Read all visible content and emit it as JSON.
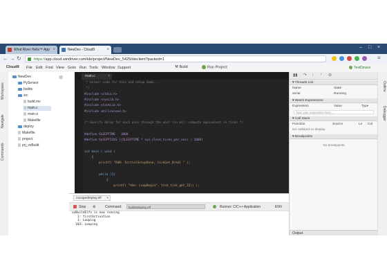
{
  "browser": {
    "tabs": [
      {
        "label": "Wind River Helix™ App"
      },
      {
        "label": "NewDev - Cloud9"
      }
    ],
    "url_scheme": "https://",
    "url_rest": "app.cloud.windriver.com/ide/project/NewDev_5425/ideclient?packed=1"
  },
  "ide": {
    "logo": "Cloud9",
    "menu": [
      "File",
      "Edit",
      "Find",
      "View",
      "Goto",
      "Run",
      "Tools",
      "Window",
      "Support"
    ],
    "build_label": "Build",
    "run_label": "Run Project",
    "device_label": "TestDevice"
  },
  "left_tabs": [
    "Workspace",
    "Navigate",
    "Commands"
  ],
  "tree": [
    {
      "label": "NewDev",
      "type": "folder",
      "indent": 0
    },
    {
      "label": "PySensor",
      "type": "folder",
      "indent": 1
    },
    {
      "label": "builds",
      "type": "folder",
      "indent": 1
    },
    {
      "label": "src",
      "type": "folder",
      "indent": 1
    },
    {
      "label": "build.mv",
      "type": "file",
      "indent": 2
    },
    {
      "label": "main.c",
      "type": "file",
      "indent": 2,
      "selected": true
    },
    {
      "label": "main.o",
      "type": "file",
      "indent": 2
    },
    {
      "label": "Makefile",
      "type": "file",
      "indent": 2
    },
    {
      "label": "deploy",
      "type": "folder",
      "indent": 1
    },
    {
      "label": "Makefile",
      "type": "file",
      "indent": 1
    },
    {
      "label": "project",
      "type": "file",
      "indent": 1
    },
    {
      "label": "prj_vxBuild",
      "type": "file",
      "indent": 1
    }
  ],
  "editor": {
    "tab_label": "main.c",
    "code": [
      " * Helper code for this and setup demo...",
      " */",
      "#include <stdio.h>",
      "#include <sysLib.h>",
      "#include <taskLib.h>",
      "#include <milisecond.h>",
      "",
      "/* Specify delay for each pass through the wait (in ms): compute equivalent in ticks */",
      "",
      "#define SLEEPTIME   1000",
      "#define SLEEPTICKS ((SLEEPTIME * sys_clock_ticks_per_sec) / 1000)",
      "",
      "int main ( void )",
      "    {",
      "        printf( \"RUN: InitialSetupDone, tickGet_0(%d) \" );",
      "",
      "        while (1)",
      "            {",
      "                printf( \"%hm: LoopBegin\", tick_tick_get_32() );",
      "",
      "                /* wait a while, then let other task have a turn */",
      "                taskDelay( SLEEPTICKS );",
      "            }",
      "",
      "    }"
    ],
    "status_pos": "24:1",
    "status_lang": "C and C++",
    "status_spaces": "Spaces: 4"
  },
  "console": {
    "tab_label": "cscope/deploy.elf",
    "stop_label": "Stop",
    "command_label": "Command:",
    "command_value": "builds/deploy.elf",
    "runner_label": "Runner: C/C++ Application",
    "env_label": "ENV",
    "output": [
      "vxBuildElfs is now running",
      "   1: firstActivation",
      "   1: Looping",
      "  103: Looping"
    ]
  },
  "debugger": {
    "sections": [
      {
        "title": "Threads List",
        "columns": [
          "Name",
          "State"
        ],
        "rows": [
          [
            "serial",
            "Running"
          ]
        ]
      },
      {
        "title": "Watch Expressions",
        "columns": [
          "Expression",
          "Value",
          "Type"
        ],
        "input_placeholder": "Type your expression here..."
      },
      {
        "title": "Call Stack",
        "columns": [
          "Function",
          "Source",
          "Ln",
          "Col"
        ],
        "empty": "No callstack to display"
      },
      {
        "title": "Breakpoints",
        "empty": "No breakpoints"
      }
    ],
    "output_label": "Output"
  },
  "right_tabs": [
    "Outline",
    "Debugger"
  ]
}
